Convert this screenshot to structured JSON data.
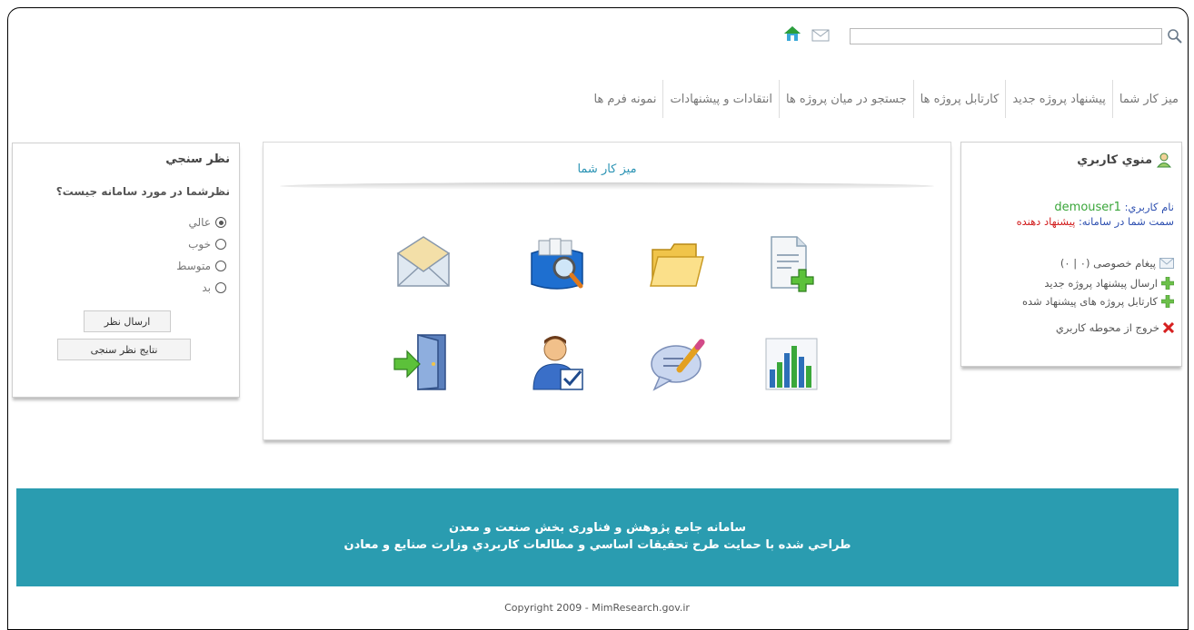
{
  "search": {
    "placeholder": ""
  },
  "nav": {
    "items": [
      "میز کار شما",
      "پیشنهاد پروژه جدید",
      "کارتابل پروژه ها",
      "جستجو در میان پروژه ها",
      "انتقادات و پیشنهادات",
      "نمونه فرم ها"
    ]
  },
  "user_menu": {
    "title": "منوي کاربري",
    "username_label": "نام کاربري:",
    "username": "demouser1",
    "role_label": "سمت شما در سامانه:",
    "role": "پیشنهاد دهنده",
    "links": [
      "پیغام خصوصی (۰ | ۰)",
      "ارسال پیشنهاد پروژه جدید",
      "کارتابل پروژه های پیشنهاد شده",
      "خروج از محوطه کاربري"
    ]
  },
  "poll": {
    "title": "نظر سنجي",
    "question": "نظرشما در مورد سامانه جیست؟",
    "options": [
      "عالي",
      "خوب",
      "متوسط",
      "بد"
    ],
    "selected": "عالي",
    "submit_label": "ارسال نظر",
    "results_label": "نتایج نظر سنجی"
  },
  "desk": {
    "title": "میز کار شما",
    "tiles": [
      "new-document-icon",
      "folder-icon",
      "search-files-icon",
      "envelope-icon",
      "chart-icon",
      "chat-edit-icon",
      "user-approve-icon",
      "exit-door-icon"
    ]
  },
  "footer": {
    "line1": "سامانه جامع پژوهش و فناوری بخش صنعت و معدن",
    "line2": "طراحي شده با حمايت طرح تحقیقات اساسي و مطالعات کاربردي وزارت صنایع و معادن",
    "copyright": "Copyright 2009 - MimResearch.gov.ir"
  },
  "colors": {
    "accent": "#2a9cb0",
    "title_blue": "#2a93b4",
    "username_green": "#3aa63a",
    "role_red": "#d11b1b"
  }
}
